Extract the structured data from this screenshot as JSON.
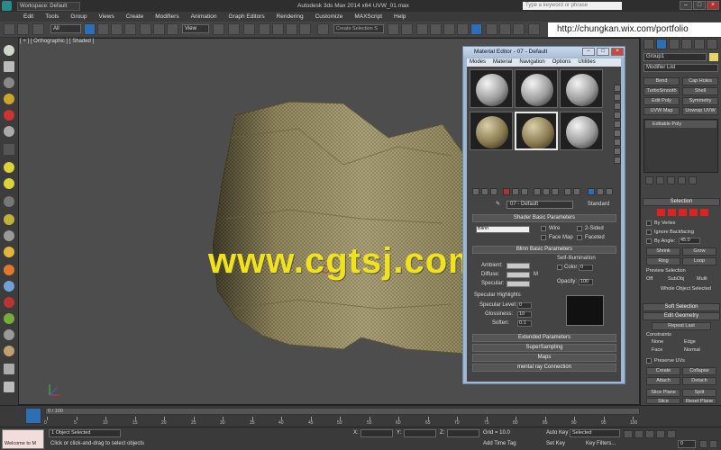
{
  "window": {
    "workspace": "Workspace: Default",
    "title": "Autodesk 3ds Max  2014 x64     UVW_01.max",
    "search_placeholder": "Type a keyword or phrase",
    "min": "–",
    "max": "□",
    "close": "×"
  },
  "menu": [
    "Edit",
    "Tools",
    "Group",
    "Views",
    "Create",
    "Modifiers",
    "Animation",
    "Graph Editors",
    "Rendering",
    "Customize",
    "MAXScript",
    "Help"
  ],
  "toolbar": {
    "selection_filter": "All",
    "ref_coord": "View",
    "named_selection": "Create Selection S"
  },
  "url_overlay": "http://chungkan.wix.com/portfolio",
  "viewport": {
    "label": "[ + ] [ Orthographic ] [ Shaded ]"
  },
  "watermark": "www.cgtsj.com",
  "material_editor": {
    "title": "Material Editor - 07 - Default",
    "menus": [
      "Modes",
      "Material",
      "Navigation",
      "Options",
      "Utilities"
    ],
    "material_name": "07 - Default",
    "material_type": "Standard",
    "shader_basic_title": "Shader Basic Parameters",
    "shader": "Blinn",
    "wire": "Wire",
    "two_sided": "2-Sided",
    "face_map": "Face Map",
    "faceted": "Faceted",
    "blinn_basic_title": "Blinn Basic Parameters",
    "self_illum_title": "Self-Illumination",
    "ambient": "Ambient:",
    "diffuse": "Diffuse:",
    "specular": "Specular:",
    "m_label": "M",
    "color_label": "Color",
    "color_value": "0",
    "opacity_label": "Opacity:",
    "opacity_value": "100",
    "spec_highlights_title": "Specular Highlights",
    "spec_level_label": "Specular Level:",
    "spec_level": "0",
    "glossiness_label": "Glossiness:",
    "glossiness": "10",
    "soften_label": "Soften:",
    "soften": "0.1",
    "rollouts": [
      "Extended Parameters",
      "SuperSampling",
      "Maps",
      "mental ray Connection"
    ]
  },
  "command_panel": {
    "object_name": "Group1",
    "modifier_list": "Modifier List",
    "buttons": [
      "Bend",
      "Cap Holes",
      "TurboSmooth",
      "Shell",
      "Edit Poly",
      "Symmetry",
      "UVW Map",
      "Unwrap UVW"
    ],
    "stack_item": "Editable Poly",
    "selection_title": "Selection",
    "by_vertex": "By Vertex",
    "ignore_backfacing": "Ignore Backfacing",
    "by_angle": "By Angle:",
    "by_angle_value": "45.0",
    "shrink": "Shrink",
    "grow": "Grow",
    "ring": "Ring",
    "loop": "Loop",
    "preview_selection": "Preview Selection",
    "off": "Off",
    "subobj": "SubObj",
    "multi": "Multi",
    "whole_object_selected": "Whole Object Selected",
    "soft_selection": "Soft Selection",
    "edit_geometry": "Edit Geometry",
    "repeat_last": "Repeat Last",
    "constraints": "Constraints",
    "none": "None",
    "edge": "Edge",
    "face": "Face",
    "normal": "Normal",
    "preserve_uvs": "Preserve UVs",
    "create": "Create",
    "collapse": "Collapse",
    "attach": "Attach",
    "detach": "Detach",
    "slice_plane": "Slice Plane",
    "split": "Split",
    "slice": "Slice",
    "reset_plane": "Reset Plane",
    "quickslice": "QuickSlice",
    "cut": "Cut"
  },
  "timeline": {
    "slider": "0 / 100",
    "ticks": [
      "0",
      "5",
      "10",
      "15",
      "20",
      "25",
      "30",
      "35",
      "40",
      "45",
      "50",
      "55",
      "60",
      "65",
      "70",
      "75",
      "80",
      "85",
      "90",
      "95",
      "100"
    ]
  },
  "status": {
    "maxscript": "Welcome to M",
    "selected": "1 Object Selected",
    "prompt": "Click or click-and-drag to select objects",
    "x_label": "X:",
    "y_label": "Y:",
    "z_label": "Z:",
    "grid": "Grid = 10.0",
    "add_time_tag": "Add Time Tag",
    "auto_key": "Auto Key",
    "auto_key_mode": "Selected",
    "set_key": "Set Key",
    "key_filters": "Key Filters...",
    "frame": "0"
  }
}
